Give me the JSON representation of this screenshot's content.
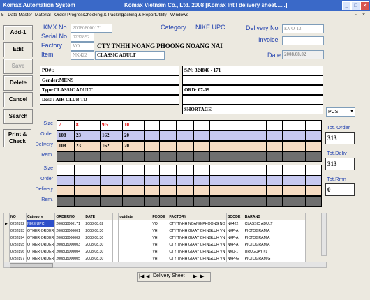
{
  "window": {
    "app_title": "Komax Automation System",
    "center_title": "Komax Vietnam Co., Ltd.   2008   [Komax Int'l delivery sheet......]"
  },
  "menu": {
    "items": [
      "5 - Data Master",
      "Material",
      "Order Progress",
      "Checking & Packing",
      "Tracking & Report",
      "Utility",
      "Windows"
    ]
  },
  "sidebar": {
    "add": "Add-1",
    "edit": "Edit",
    "save": "Save",
    "delete": "Delete",
    "cancel": "Cancel",
    "search": "Search",
    "print_line1": "Print &",
    "print_line2": "Check"
  },
  "header": {
    "kmx_label": "KMX No.",
    "kmx_value": "200808000171",
    "serial_label": "Serial No.",
    "serial_value": "0232892",
    "factory_label": "Factory",
    "factory_code": "VO",
    "factory_name": "CTY TNHH NOANG PHOONG NOANG NAI",
    "item_label": "Item",
    "item_code": "NK422",
    "item_name": "CLASSIC ADULT",
    "category_label": "Category",
    "category_value": "NIKE UPC",
    "delivery_label": "Delivery No",
    "delivery_value": "KVO-12",
    "invoice_label": "Invoice",
    "invoice_value": "",
    "date_label": "Date",
    "date_value": "2008.08.02"
  },
  "info": {
    "po": "PO# :",
    "gender": "Gender:MENS",
    "type": "Type:CLASSIC ADULT",
    "desc": "Desc  : AIR CLUB TD",
    "sn": "S/N: 324846 - 171",
    "ord": "ORD: 07-09",
    "shortage": "SHORTAGE"
  },
  "grid1": {
    "labels": [
      "Size",
      "Order",
      "Delivery",
      "Rem."
    ],
    "sizes": [
      "7",
      "8",
      "9.5",
      "10"
    ],
    "order": [
      "108",
      "23",
      "162",
      "20"
    ],
    "delivery": [
      "108",
      "23",
      "162",
      "20"
    ]
  },
  "grid2": {
    "labels": [
      "Size",
      "Order",
      "Delivery",
      "Rem."
    ]
  },
  "totals": {
    "unit": "PCS",
    "order_label": "Tot. Order",
    "order_value": "313",
    "deliv_label": "Tot.Deliv",
    "deliv_value": "313",
    "rmn_label": "Tot.Rmn",
    "rmn_value": "0"
  },
  "table": {
    "headers": [
      "NO",
      "Category",
      "ORDERNO",
      "DATE",
      "",
      "outdate",
      "FCODE",
      "FACTORY",
      "BCODE",
      "BARANG"
    ],
    "rows": [
      [
        "0232892",
        "NIKE UPC",
        "200808000171",
        "2008.08.02",
        "",
        "",
        "VO",
        "CTY TNHH NOANG PHOONG NO",
        "NK422",
        "CLASSIC ADULT"
      ],
      [
        "0232893",
        "OTHER ORDER",
        "200808000001",
        "2008.08.30",
        "",
        "",
        "VH",
        "CTY TNHH GIAAY CHINGLUH VN",
        "NKP-A",
        "PICTOGRAM A"
      ],
      [
        "0232894",
        "OTHER ORDER",
        "200808000002",
        "2008.08.30",
        "",
        "",
        "VH",
        "CTY TNHH GIAAY CHINGLUH VN",
        "NKP-A",
        "PICTOGRAM A"
      ],
      [
        "0232895",
        "OTHER ORDER",
        "200808000003",
        "2008.08.30",
        "",
        "",
        "VH",
        "CTY TNHH GIAAY CHINGLUH VN",
        "NKP-A",
        "PICTOGRAM A"
      ],
      [
        "0232896",
        "OTHER ORDER",
        "200808000004",
        "2008.08.30",
        "",
        "",
        "VH",
        "CTY TNHH GIAAY CHINGLUH VN",
        "NKU-1",
        "URUGUAY #1"
      ],
      [
        "0232897",
        "OTHER ORDER",
        "200808000005",
        "2008.08.30",
        "",
        "",
        "VH",
        "CTY TNHH GIAAY CHINGLUH VN",
        "NKP-G",
        "PICTOGRAM G"
      ]
    ]
  },
  "nav": {
    "label": "Delivery Sheet"
  },
  "colors": {
    "titlebar": "#3a69c8",
    "label_blue": "#1f3fae",
    "order_row": "#c7c9f0",
    "delivery_row": "#f6dcc3",
    "rem_row": "#6f6f6f",
    "size_red": "#e00000"
  }
}
